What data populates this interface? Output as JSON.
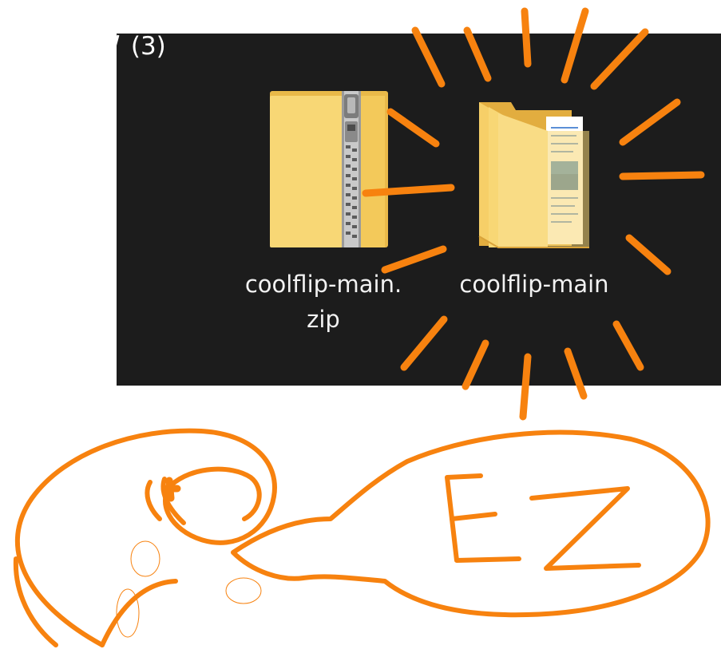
{
  "explorer": {
    "group_header_count": "(3)",
    "files": [
      {
        "name": "coolflip-main.zip",
        "icon": "zip-folder-icon"
      },
      {
        "name": "coolflip-main",
        "icon": "folder-icon"
      }
    ]
  },
  "annotation": {
    "speech_text": "EZ",
    "color": "#f7820f"
  },
  "colors": {
    "explorer_background": "#1c1c1c",
    "label_text": "#f2f2f2",
    "folder_yellow": "#f8d775"
  }
}
